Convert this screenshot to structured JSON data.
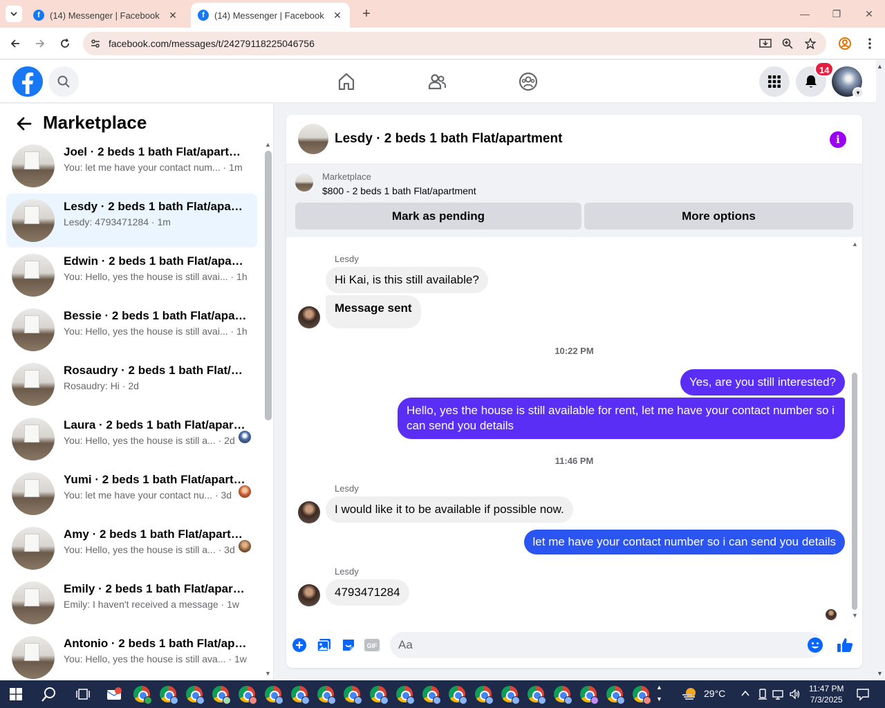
{
  "browser": {
    "tabs": [
      {
        "title": "(14) Messenger | Facebook",
        "active": false
      },
      {
        "title": "(14) Messenger | Facebook",
        "active": true
      }
    ],
    "url": "facebook.com/messages/t/24279118225046756"
  },
  "fb_header": {
    "notification_count": "14"
  },
  "left_panel": {
    "title": "Marketplace",
    "conversations": [
      {
        "name": "Joel · 2 beds 1 bath Flat/apartment",
        "preview": "You: let me have your contact num... · 1m",
        "active": false
      },
      {
        "name": "Lesdy · 2 beds 1 bath Flat/apartment",
        "preview": "Lesdy: 4793471284 · 1m",
        "active": true
      },
      {
        "name": "Edwin · 2 beds 1 bath Flat/apartment",
        "preview": "You: Hello, yes the house is still avai... · 1h",
        "active": false
      },
      {
        "name": "Bessie · 2 beds 1 bath Flat/apartment",
        "preview": "You: Hello, yes the house is still avai... · 1h",
        "active": false
      },
      {
        "name": "Rosaudry · 2 beds 1 bath Flat/apartment",
        "preview": "Rosaudry: Hi · 2d",
        "active": false
      },
      {
        "name": "Laura · 2 beds 1 bath Flat/apartment",
        "preview": "You: Hello, yes the house is still a... · 2d",
        "active": false
      },
      {
        "name": "Yumi · 2 beds 1 bath Flat/apartment",
        "preview": "You: let me have your contact nu... · 3d",
        "active": false
      },
      {
        "name": "Amy · 2 beds 1 bath Flat/apartment",
        "preview": "You: Hello, yes the house is still a... · 3d",
        "active": false
      },
      {
        "name": "Emily · 2 beds 1 bath Flat/apartment",
        "preview": "Emily: I haven't received a message · 1w",
        "active": false
      },
      {
        "name": "Antonio · 2 beds 1 bath Flat/apartment",
        "preview": "You: Hello, yes the house is still ava... · 1w",
        "active": false
      }
    ]
  },
  "chat": {
    "title": "Lesdy · 2 beds 1 bath Flat/apartment",
    "marketplace_label": "Marketplace",
    "listing": "$800 - 2 beds 1 bath Flat/apartment",
    "mark_pending_label": "Mark as pending",
    "more_options_label": "More options",
    "sender_name": "Lesdy",
    "messages": {
      "m1": "Hi Kai, is this still available?",
      "m2": "Message sent",
      "ts1": "10:22 PM",
      "m3": "Yes, are you still interested?",
      "m4": "Hello, yes the house is still available for rent, let me have your contact number so i can send you details",
      "ts2": "11:46 PM",
      "m5": "I would like it to be available if possible now.",
      "m6": "let me have your contact number so i can send you details",
      "m7": "4793471284"
    },
    "composer_placeholder": "Aa"
  },
  "taskbar": {
    "temperature": "29°C",
    "time": "11:47 PM",
    "date": "7/3/2025"
  },
  "colors": {
    "fb_blue": "#1877f2",
    "outgoing_bubble": "#5a2ef5",
    "badge_red": "#e41e3f",
    "info_purple": "#9b00f5"
  }
}
